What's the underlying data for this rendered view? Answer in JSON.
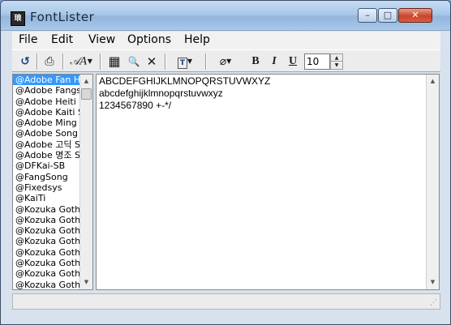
{
  "window": {
    "title": "FontLister",
    "icon_label": "琅",
    "controls": {
      "minimize": "–",
      "maximize": "□",
      "close": "✕"
    }
  },
  "menu": [
    "File",
    "Edit",
    "View",
    "Options",
    "Help"
  ],
  "toolbar": {
    "refresh_icon": "↺",
    "print_icon": "⎙",
    "font_icon": "𝒜A",
    "grid_icon": "▦",
    "preview_icon": "🔍",
    "delete_icon": "✕",
    "text_icon": "T",
    "eraser_icon": "⌀",
    "bold": "B",
    "italic": "I",
    "underline": "U",
    "size_value": "10",
    "spin_up": "▲",
    "spin_down": "▼"
  },
  "fonts": [
    "@Adobe Fan Heiti",
    "@Adobe Fangsong",
    "@Adobe Heiti Std",
    "@Adobe Kaiti Std",
    "@Adobe Ming Std",
    "@Adobe Song Std",
    "@Adobe 고딕 Std",
    "@Adobe 명조 Std",
    "@DFKai-SB",
    "@FangSong",
    "@Fixedsys",
    "@KaiTi",
    "@Kozuka Gothic",
    "@Kozuka Gothic",
    "@Kozuka Gothic",
    "@Kozuka Gothic",
    "@Kozuka Gothic",
    "@Kozuka Gothic",
    "@Kozuka Gothic",
    "@Kozuka Gothic"
  ],
  "selected_font_index": 0,
  "preview": {
    "line1": "ABCDEFGHIJKLMNOPQRSTUVWXYZ",
    "line2": "abcdefghijklmnopqrstuvwxyz",
    "line3": "1234567890 +-*/"
  },
  "scroll": {
    "up_icon": "▲",
    "down_icon": "▼"
  },
  "status": "",
  "colors": {
    "selection": "#3399ff",
    "close_button": "#c9442a"
  }
}
